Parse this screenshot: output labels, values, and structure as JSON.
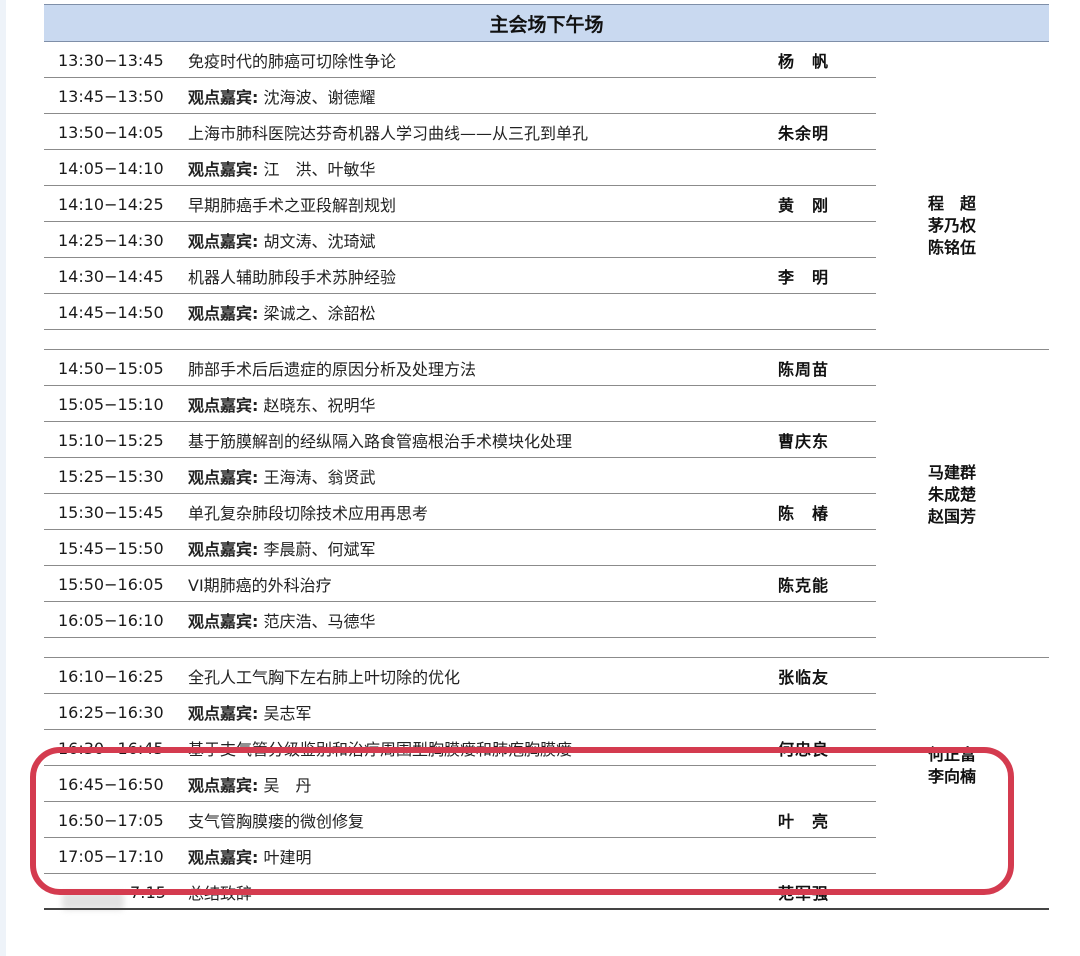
{
  "header": {
    "title": "主会场下午场"
  },
  "viewpoint_label": "观点嘉宾:",
  "sessions": [
    {
      "chairs": [
        "程　超",
        "茅乃权",
        "陈铭伍"
      ],
      "rows": [
        {
          "time": "13:30−13:45",
          "topic": "免疫时代的肺癌可切除性争论",
          "speaker": "杨　帆"
        },
        {
          "time": "13:45−13:50",
          "guests": "沈海波、谢德耀"
        },
        {
          "time": "13:50−14:05",
          "topic": "上海市肺科医院达芬奇机器人学习曲线——从三孔到单孔",
          "speaker": "朱余明"
        },
        {
          "time": "14:05−14:10",
          "guests": "江　洪、叶敏华"
        },
        {
          "time": "14:10−14:25",
          "topic": "早期肺癌手术之亚段解剖规划",
          "speaker": "黄　刚"
        },
        {
          "time": "14:25−14:30",
          "guests": "胡文涛、沈琦斌"
        },
        {
          "time": "14:30−14:45",
          "topic": "机器人辅助肺段手术苏肿经验",
          "speaker": "李　明"
        },
        {
          "time": "14:45−14:50",
          "guests": "梁诚之、涂韶松"
        }
      ]
    },
    {
      "chairs": [
        "马建群",
        "朱成楚",
        "赵国芳"
      ],
      "rows": [
        {
          "time": "14:50−15:05",
          "topic": "肺部手术后后遗症的原因分析及处理方法",
          "speaker": "陈周苗"
        },
        {
          "time": "15:05−15:10",
          "guests": "赵晓东、祝明华"
        },
        {
          "time": "15:10−15:25",
          "topic": "基于筋膜解剖的经纵隔入路食管癌根治手术模块化处理",
          "speaker": "曹庆东"
        },
        {
          "time": "15:25−15:30",
          "guests": "王海涛、翁贤武"
        },
        {
          "time": "15:30−15:45",
          "topic": "单孔复杂肺段切除技术应用再思考",
          "speaker": "陈　椿"
        },
        {
          "time": "15:45−15:50",
          "guests": "李晨蔚、何斌军"
        },
        {
          "time": "15:50−16:05",
          "topic": "VI期肺癌的外科治疗",
          "speaker": "陈克能"
        },
        {
          "time": "16:05−16:10",
          "guests": "范庆浩、马德华"
        }
      ]
    },
    {
      "chairs": [
        "何正富",
        "李向楠"
      ],
      "rows": [
        {
          "time": "16:10−16:25",
          "topic": "全孔人工气胸下左右肺上叶切除的优化",
          "speaker": "张临友"
        },
        {
          "time": "16:25−16:30",
          "guests": "吴志军"
        },
        {
          "time": "16:30−16:45",
          "topic": "基于支气管分级鉴别和治疗周围型胸膜瘘和肺疱胸膜瘘",
          "speaker": "何忠良"
        },
        {
          "time": "16:45−16:50",
          "guests": "吴　丹"
        },
        {
          "time": "16:50−17:05",
          "topic": "支气管胸膜瘘的微创修复",
          "speaker": "叶　亮"
        },
        {
          "time": "17:05−17:10",
          "guests": "叶建明"
        }
      ]
    }
  ],
  "closing": {
    "time_visible": "7:15",
    "topic": "总结致辞",
    "speaker": "范军强"
  }
}
